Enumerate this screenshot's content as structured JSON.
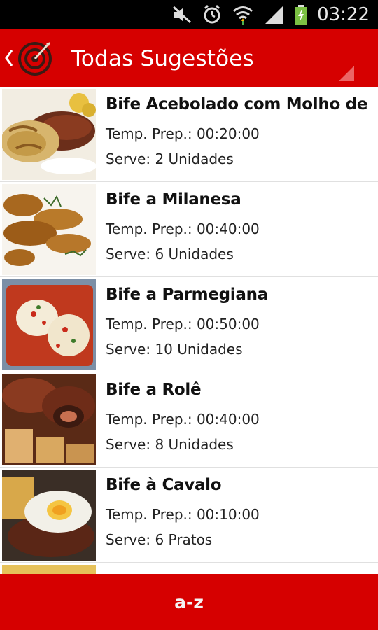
{
  "status_bar": {
    "time": "03:22",
    "icons": [
      "mute-icon",
      "alarm-icon",
      "wifi-icon",
      "signal-icon",
      "battery-charging-icon"
    ]
  },
  "app_bar": {
    "title": "Todas Sugestões",
    "logo_icon": "target-logo-icon",
    "accent_color": "#d60000"
  },
  "recipes": [
    {
      "title": "Bife Acebolado com Molho de",
      "prep": "Temp. Prep.: 00:20:00",
      "serve": "Serve: 2 Unidades",
      "image": "steak-with-onion-sauce"
    },
    {
      "title": "Bife a Milanesa",
      "prep": "Temp. Prep.: 00:40:00",
      "serve": "Serve: 6 Unidades",
      "image": "breaded-steak"
    },
    {
      "title": "Bife a Parmegiana",
      "prep": "Temp. Prep.: 00:50:00",
      "serve": "Serve: 10 Unidades",
      "image": "parmigiana-steak"
    },
    {
      "title": "Bife a Rolê",
      "prep": "Temp. Prep.: 00:40:00",
      "serve": "Serve: 8 Unidades",
      "image": "rolled-beef"
    },
    {
      "title": "Bife à Cavalo",
      "prep": "Temp. Prep.: 00:10:00",
      "serve": "Serve: 6 Pratos",
      "image": "steak-with-fried-egg"
    }
  ],
  "bottom_bar": {
    "sort_label": "a-z"
  }
}
